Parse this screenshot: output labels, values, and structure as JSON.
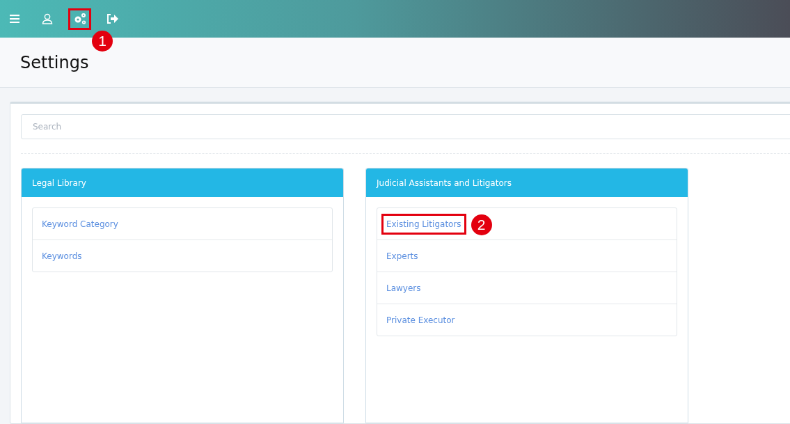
{
  "toolbar": {
    "icons": [
      {
        "kind": "menu",
        "highlighted": false
      },
      {
        "kind": "user",
        "highlighted": false
      },
      {
        "kind": "settings",
        "highlighted": true,
        "callout": "1"
      },
      {
        "kind": "logout",
        "highlighted": false
      }
    ]
  },
  "page_title": "Settings",
  "search": {
    "placeholder": "Search"
  },
  "panels": [
    {
      "title": "Legal Library",
      "items": [
        {
          "label": "Keyword Category",
          "highlighted": false
        },
        {
          "label": "Keywords",
          "highlighted": false
        }
      ]
    },
    {
      "title": "Judicial Assistants and Litigators",
      "items": [
        {
          "label": "Existing Litigators",
          "highlighted": true,
          "callout": "2"
        },
        {
          "label": "Experts",
          "highlighted": false
        },
        {
          "label": "Lawyers",
          "highlighted": false
        },
        {
          "label": "Private Executor",
          "highlighted": false
        }
      ]
    }
  ]
}
